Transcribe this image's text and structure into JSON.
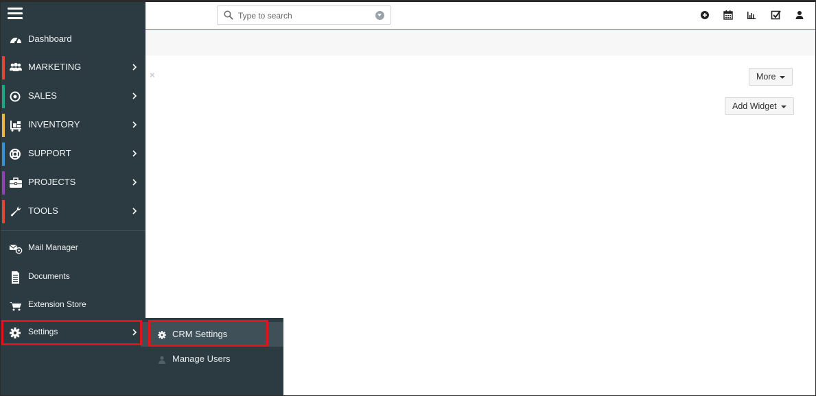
{
  "search": {
    "placeholder": "Type to search"
  },
  "topbar_icons": [
    "plus-circle-icon",
    "calendar-icon",
    "bar-chart-icon",
    "checkbox-icon",
    "user-icon"
  ],
  "main": {
    "more_label": "More",
    "add_widget_label": "Add Widget",
    "close_glyph": "×"
  },
  "sidebar": {
    "dashboard": "Dashboard",
    "items": [
      {
        "label": "MARKETING",
        "color": "#e0453a",
        "icon": "users-icon"
      },
      {
        "label": "SALES",
        "color": "#1ba784",
        "icon": "target-icon"
      },
      {
        "label": "INVENTORY",
        "color": "#e7b73e",
        "icon": "dolly-icon"
      },
      {
        "label": "SUPPORT",
        "color": "#3a8fcf",
        "icon": "lifebuoy-icon"
      },
      {
        "label": "PROJECTS",
        "color": "#8e44ad",
        "icon": "briefcase-icon"
      },
      {
        "label": "TOOLS",
        "color": "#e0453a",
        "icon": "wrench-icon"
      }
    ],
    "mail_manager": "Mail Manager",
    "documents": "Documents",
    "extension_store": "Extension Store",
    "settings": "Settings"
  },
  "submenu": {
    "crm_settings": "CRM Settings",
    "manage_users": "Manage Users"
  }
}
